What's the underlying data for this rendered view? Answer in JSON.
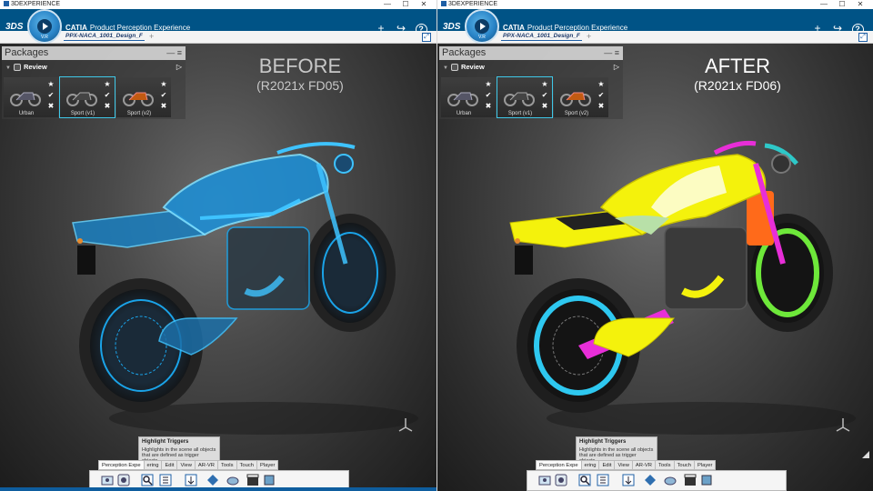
{
  "panes": [
    {
      "window_title": "3DEXPERIENCE",
      "brand_title": "CATIA",
      "app_name": "Product Perception Experience",
      "compass_version": "V.R",
      "doc_tab": "PPX-NACA_1001_Design_F",
      "packages_title": "Packages",
      "review_label": "Review",
      "thumbnails": [
        "Urban",
        "Sport (v1)",
        "Sport (v2)"
      ],
      "heading": "BEFORE",
      "subheading": "(R2021x FD05)",
      "tooltip_title": "Highlight Triggers",
      "tooltip_text": "Highlights in the scene all objects that are defined as trigger objects.",
      "toolbar_tabs": [
        "Perception Expe",
        "ering",
        "Edit",
        "View",
        "AR-VR",
        "Tools",
        "Touch",
        "Player"
      ],
      "style": "xray-blue"
    },
    {
      "window_title": "3DEXPERIENCE",
      "brand_title": "CATIA",
      "app_name": "Product Perception Experience",
      "compass_version": "V.R",
      "doc_tab": "PPX-NACA_1001_Design_F",
      "packages_title": "Packages",
      "review_label": "Review",
      "thumbnails": [
        "Urban",
        "Sport (v1)",
        "Sport (v2)"
      ],
      "heading": "AFTER",
      "subheading": "(R2021x FD06)",
      "tooltip_title": "Highlight Triggers",
      "tooltip_text": "Highlights in the scene all objects that are defined as trigger objects.",
      "toolbar_tabs": [
        "Perception Expe",
        "ering",
        "Edit",
        "View",
        "AR-VR",
        "Tools",
        "Touch",
        "Player"
      ],
      "style": "multicolor"
    }
  ],
  "window_controls": [
    "—",
    "☐",
    "✕"
  ],
  "header_icons": [
    "plus-icon",
    "share-icon",
    "help-icon"
  ],
  "colors": {
    "header_blue": "#005386",
    "xray_blue": "#1aa3e8",
    "highlight_yellow": "#f4f20c",
    "highlight_magenta": "#e82ed8",
    "highlight_cyan": "#2ec8f0",
    "highlight_green": "#6ee83a",
    "highlight_orange": "#ff6a1a"
  }
}
